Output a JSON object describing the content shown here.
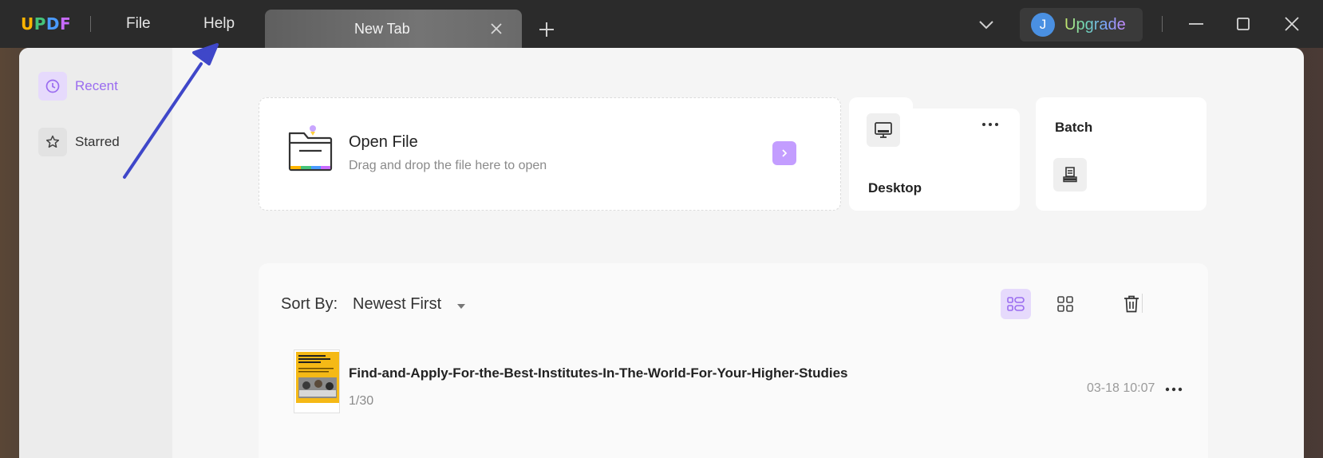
{
  "app": {
    "logo_letters": [
      "U",
      "P",
      "D",
      "F"
    ],
    "colors": {
      "accent": "#b58cff",
      "logo": [
        "#ffb400",
        "#45c37a",
        "#4a9bff",
        "#c86bff"
      ],
      "annotation_arrow": "#3f47c9"
    }
  },
  "titlebar": {
    "menu": [
      {
        "label": "File"
      },
      {
        "label": "Help"
      }
    ],
    "tab": {
      "title": "New Tab",
      "close_icon": "close-icon"
    },
    "new_tab_icon": "plus-icon",
    "dropdown_icon": "chevron-down-icon",
    "user": {
      "initial": "J",
      "upgrade_label": "Upgrade"
    },
    "window_controls": [
      "minimize-icon",
      "maximize-icon",
      "close-icon"
    ]
  },
  "sidebar": {
    "items": [
      {
        "label": "Recent",
        "icon": "clock-icon",
        "active": true
      },
      {
        "label": "Starred",
        "icon": "star-icon",
        "active": false
      }
    ]
  },
  "quick_actions": {
    "open_file": {
      "title": "Open File",
      "subtitle": "Drag and drop the file here to open",
      "icon": "folder-icon"
    },
    "desktop": {
      "label": "Desktop",
      "icon": "monitor-icon",
      "more_icon": "more-horizontal-icon"
    },
    "batch": {
      "label": "Batch",
      "icon": "stack-icon"
    }
  },
  "files": {
    "sort_label": "Sort By:",
    "sort_value": "Newest First",
    "view_modes": [
      "list-view-icon",
      "grid-view-icon"
    ],
    "delete_icon": "trash-icon",
    "items": [
      {
        "name": "Find-and-Apply-For-the-Best-Institutes-In-The-World-For-Your-Higher-Studies",
        "pages": "1/30",
        "date": "03-18 10:07"
      }
    ]
  }
}
